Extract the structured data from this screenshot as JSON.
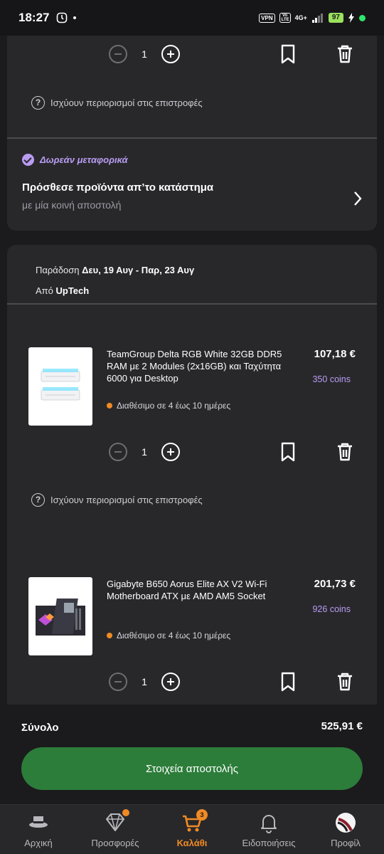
{
  "status_bar": {
    "time": "18:27",
    "vpn": "VPN",
    "volte": "Vo LTE",
    "network": "4G+",
    "battery": "97"
  },
  "top_item": {
    "quantity": "1",
    "returns_text": "Ισχύουν περιορισμοί στις επιστροφές"
  },
  "shipping_promo": {
    "free_label": "Δωρεάν μεταφορικά",
    "title": "Πρόσθεσε προϊόντα απ’το κατάστημα",
    "subtitle": "με μία κοινή αποστολή"
  },
  "shipment": {
    "delivery_prefix": "Παράδοση",
    "delivery_dates": "Δευ, 19 Αυγ - Παρ, 23 Αυγ",
    "from_prefix": "Από",
    "seller": "UpTech"
  },
  "products": [
    {
      "title": "TeamGroup Delta RGB White 32GB DDR5 RAM με 2 Modules (2x16GB) και Ταχύτητα 6000 για Desktop",
      "price": "107,18 €",
      "coins": "350 coins",
      "availability": "Διαθέσιμο σε 4 έως 10 ημέρες",
      "quantity": "1",
      "returns_text": "Ισχύουν περιορισμοί στις επιστροφές"
    },
    {
      "title": "Gigabyte B650 Aorus Elite AX V2 Wi-Fi Motherboard ATX με AMD AM5 Socket",
      "price": "201,73 €",
      "coins": "926 coins",
      "availability": "Διαθέσιμο σε 4 έως 10 ημέρες",
      "quantity": "1"
    }
  ],
  "summary": {
    "total_label": "Σύνολο",
    "total_value": "525,91 €",
    "cta_label": "Στοιχεία αποστολής"
  },
  "bottom_nav": {
    "items": [
      {
        "label": "Αρχική",
        "icon": "home-hat-icon"
      },
      {
        "label": "Προσφορές",
        "icon": "diamond-icon"
      },
      {
        "label": "Καλάθι",
        "icon": "cart-icon",
        "badge": "3",
        "active": true
      },
      {
        "label": "Ειδοποιήσεις",
        "icon": "bell-icon"
      },
      {
        "label": "Προφίλ",
        "icon": "profile-avatar"
      }
    ]
  },
  "colors": {
    "background": "#1b1b1d",
    "card": "#28282b",
    "accent_purple": "#b99cf2",
    "accent_orange": "#f08a24",
    "cta_green": "#2c7d3a"
  }
}
